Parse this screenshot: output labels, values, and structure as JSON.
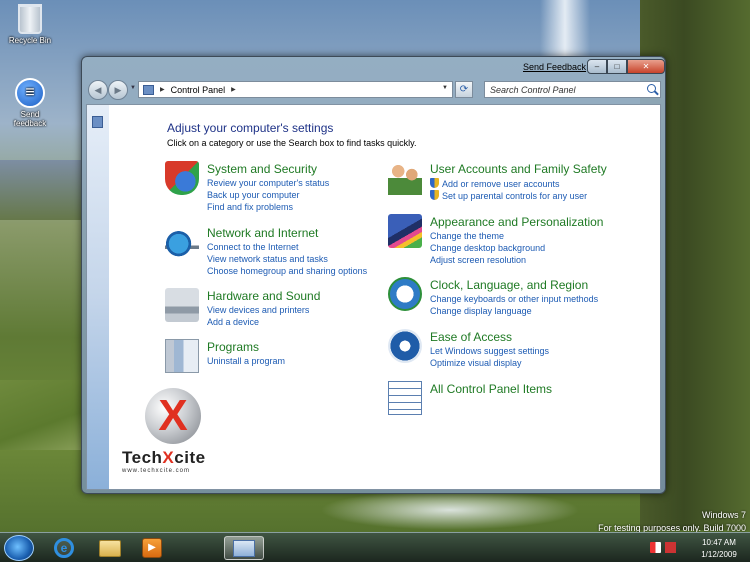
{
  "desktop": {
    "icons": [
      {
        "label": "Recycle Bin",
        "icon": "recycle-bin-icon"
      },
      {
        "label": "Send feedback",
        "icon": "feedback-icon"
      }
    ],
    "watermark": {
      "line1": "Windows 7",
      "line2": "For testing purposes only. Build 7000"
    }
  },
  "window": {
    "send_feedback": "Send Feedback",
    "caption": {
      "minimize": "–",
      "maximize": "□",
      "close": "✕"
    },
    "nav": {
      "back_glyph": "◀",
      "forward_glyph": "▶",
      "dropdown_glyph": "▼",
      "address_arrow": "▶",
      "address_text": "Control Panel",
      "refresh_glyph": "⟳",
      "search_placeholder": "Search Control Panel"
    },
    "heading": "Adjust your computer's settings",
    "subheading": "Click on a category or use the Search box to find tasks quickly.",
    "categories_left": [
      {
        "title": "System and Security",
        "icon": "security-shield-icon",
        "links": [
          "Review your computer's status",
          "Back up your computer",
          "Find and fix problems"
        ]
      },
      {
        "title": "Network and Internet",
        "icon": "network-globe-icon",
        "links": [
          "Connect to the Internet",
          "View network status and tasks",
          "Choose homegroup and sharing options"
        ]
      },
      {
        "title": "Hardware and Sound",
        "icon": "printer-icon",
        "links": [
          "View devices and printers",
          "Add a device"
        ]
      },
      {
        "title": "Programs",
        "icon": "programs-icon",
        "links": [
          "Uninstall a program"
        ]
      }
    ],
    "categories_right": [
      {
        "title": "User Accounts and Family Safety",
        "icon": "users-icon",
        "links": [
          "Add or remove user accounts",
          "Set up parental controls for any user"
        ]
      },
      {
        "title": "Appearance and Personalization",
        "icon": "appearance-icon",
        "links": [
          "Change the theme",
          "Change desktop background",
          "Adjust screen resolution"
        ]
      },
      {
        "title": "Clock, Language, and Region",
        "icon": "clock-globe-icon",
        "links": [
          "Change keyboards or other input methods",
          "Change display language"
        ]
      },
      {
        "title": "Ease of Access",
        "icon": "ease-of-access-icon",
        "links": [
          "Let Windows suggest settings",
          "Optimize visual display"
        ]
      },
      {
        "title": "All Control Panel Items",
        "icon": "all-items-icon",
        "links": []
      }
    ],
    "logo": {
      "prefix": "Tech",
      "x": "X",
      "suffix": "cite",
      "url": "www.techxcite.com"
    }
  },
  "taskbar": {
    "items": [
      "start-button",
      "internet-explorer",
      "windows-explorer",
      "media-player",
      "control-panel"
    ],
    "media_glyph": "▶",
    "ie_glyph": "e",
    "clock": {
      "time": "10:47 AM",
      "date": "1/12/2009"
    }
  }
}
